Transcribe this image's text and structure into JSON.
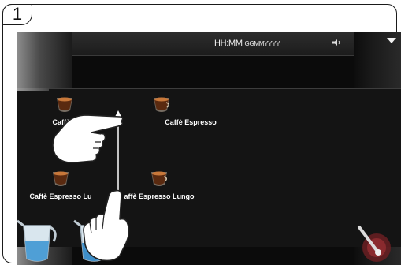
{
  "step": {
    "number": "1"
  },
  "status_bar": {
    "time_format": "HH:MM",
    "date_format": "GGMMYYYY",
    "icons": [
      "volume-icon",
      "chevron-down-icon"
    ]
  },
  "products": [
    {
      "label": "Caffè Espresso",
      "shown": "Caffè E"
    },
    {
      "label": "Caffè Espresso"
    },
    {
      "label": "Caffè Espresso Lungo",
      "shown": "Caffè Espresso Lu"
    },
    {
      "label": "Caffè Espresso Lungo",
      "shown": "affè Espresso Lungo"
    }
  ],
  "accessories": [
    "milk-jug-icon",
    "hot-water-jug-icon",
    "steam-wand-icon"
  ],
  "gesture": {
    "type": "swipe-vertical",
    "icons": [
      "hand-pointer-icon",
      "hand-pointer-icon"
    ]
  },
  "colors": {
    "display_bg": "#0b0b0b",
    "text": "#ffffff",
    "frame": "#1a1a1a"
  }
}
